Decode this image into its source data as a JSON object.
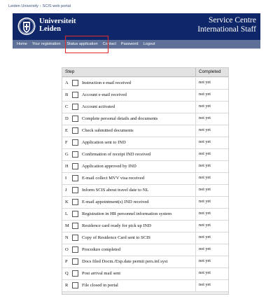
{
  "breadcrumb": {
    "root": "Leiden University",
    "separator": "›",
    "current": "SCIS web portal"
  },
  "header": {
    "university_line1": "Universiteit",
    "university_line2": "Leiden",
    "title_line1": "Service Centre",
    "title_line2": "International Staff"
  },
  "colors": {
    "header_bg": "#0f2769",
    "nav_bg": "#5e7097",
    "highlight": "#e22b2b"
  },
  "nav": {
    "items": [
      {
        "label": "Home"
      },
      {
        "label": "Your registration"
      },
      {
        "label": "Status application",
        "highlighted": true
      },
      {
        "label": "Contact"
      },
      {
        "label": "Password"
      },
      {
        "label": "Logout"
      }
    ]
  },
  "table": {
    "col_step": "Step",
    "col_completed": "Completed",
    "rows": [
      {
        "letter": "A",
        "label": "Instruction e-mail received",
        "status": "not yet",
        "checked": false
      },
      {
        "letter": "B",
        "label": "Account e-mail received",
        "status": "not yet",
        "checked": false
      },
      {
        "letter": "C",
        "label": "Account activated",
        "status": "not yet",
        "checked": false
      },
      {
        "letter": "D",
        "label": "Complete personal details and documents",
        "status": "not yet",
        "checked": false
      },
      {
        "letter": "E",
        "label": "Check submitted documents",
        "status": "not yet",
        "checked": false
      },
      {
        "letter": "F",
        "label": "Application sent to IND",
        "status": "not yet",
        "checked": false
      },
      {
        "letter": "G",
        "label": "Confirmation of receipt IND received",
        "status": "not yet",
        "checked": false
      },
      {
        "letter": "H",
        "label": "Application approved by IND",
        "status": "not yet",
        "checked": false
      },
      {
        "letter": "I",
        "label": "E-mail collect MVV visa received",
        "status": "not yet",
        "checked": false
      },
      {
        "letter": "J",
        "label": "Inform SCIS about travel date to NL",
        "status": "not yet",
        "checked": false
      },
      {
        "letter": "K",
        "label": "E-mail appointment(s) IND received",
        "status": "not yet",
        "checked": false
      },
      {
        "letter": "L",
        "label": "Registration in HR personnel information system",
        "status": "not yet",
        "checked": false
      },
      {
        "letter": "M",
        "label": "Residence card ready for pick up IND",
        "status": "not yet",
        "checked": false
      },
      {
        "letter": "N",
        "label": "Copy of Residence Card sent to SCIS",
        "status": "not yet",
        "checked": false
      },
      {
        "letter": "O",
        "label": "Procedure completed",
        "status": "not yet",
        "checked": false
      },
      {
        "letter": "P",
        "label": "Docs filed Docm./Exp.date permit pers.inf.syst",
        "status": "not yet",
        "checked": false
      },
      {
        "letter": "Q",
        "label": "Post arrival mail sent",
        "status": "not yet",
        "checked": false
      },
      {
        "letter": "R",
        "label": "File closed in portal",
        "status": "not yet",
        "checked": false
      }
    ]
  }
}
